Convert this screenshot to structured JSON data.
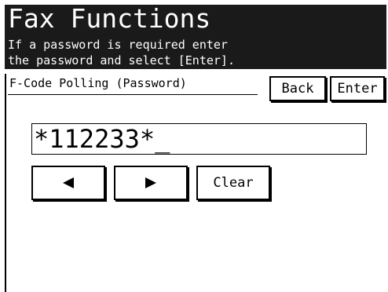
{
  "header": {
    "title": "Fax Functions",
    "message_line1": "If a password is required enter",
    "message_line2": "the password and select [Enter]."
  },
  "screen": {
    "subtitle": "F-Code Polling (Password)"
  },
  "buttons": {
    "back_label": "Back",
    "enter_label": "Enter",
    "clear_label": "Clear",
    "left_icon": "left-arrow-icon",
    "right_icon": "right-arrow-icon"
  },
  "password_field": {
    "value": "*112233*_"
  },
  "colors": {
    "header_background": "#1a1a1a",
    "header_text": "#ffffff",
    "screen_background": "#ffffff",
    "foreground": "#000000"
  }
}
